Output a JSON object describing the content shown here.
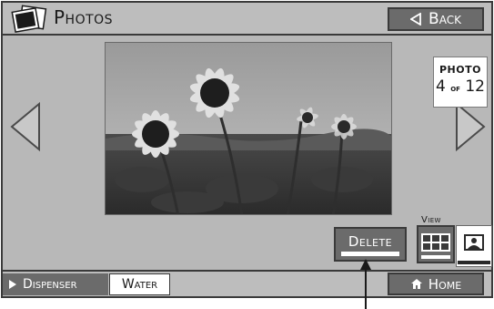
{
  "header": {
    "title": "Photos",
    "back_label": "Back"
  },
  "counter": {
    "label": "PHOTO",
    "current": "4",
    "of": "of",
    "total": "12"
  },
  "actions": {
    "delete_label": "Delete",
    "view_label": "View"
  },
  "bottom": {
    "dispenser_label": "Dispenser",
    "water_label": "Water",
    "home_label": "Home"
  },
  "icons": {
    "logo": "photos-logo-icon",
    "back": "triangle-left-icon",
    "prev": "chevron-left-icon",
    "next": "chevron-right-icon",
    "grid": "grid-view-icon",
    "single": "single-photo-view-icon",
    "play": "play-icon",
    "home": "house-icon"
  },
  "colors": {
    "screen_bg": "#b8b8b8",
    "button_bg": "#6b6b6b",
    "border": "#3a3a3a"
  }
}
